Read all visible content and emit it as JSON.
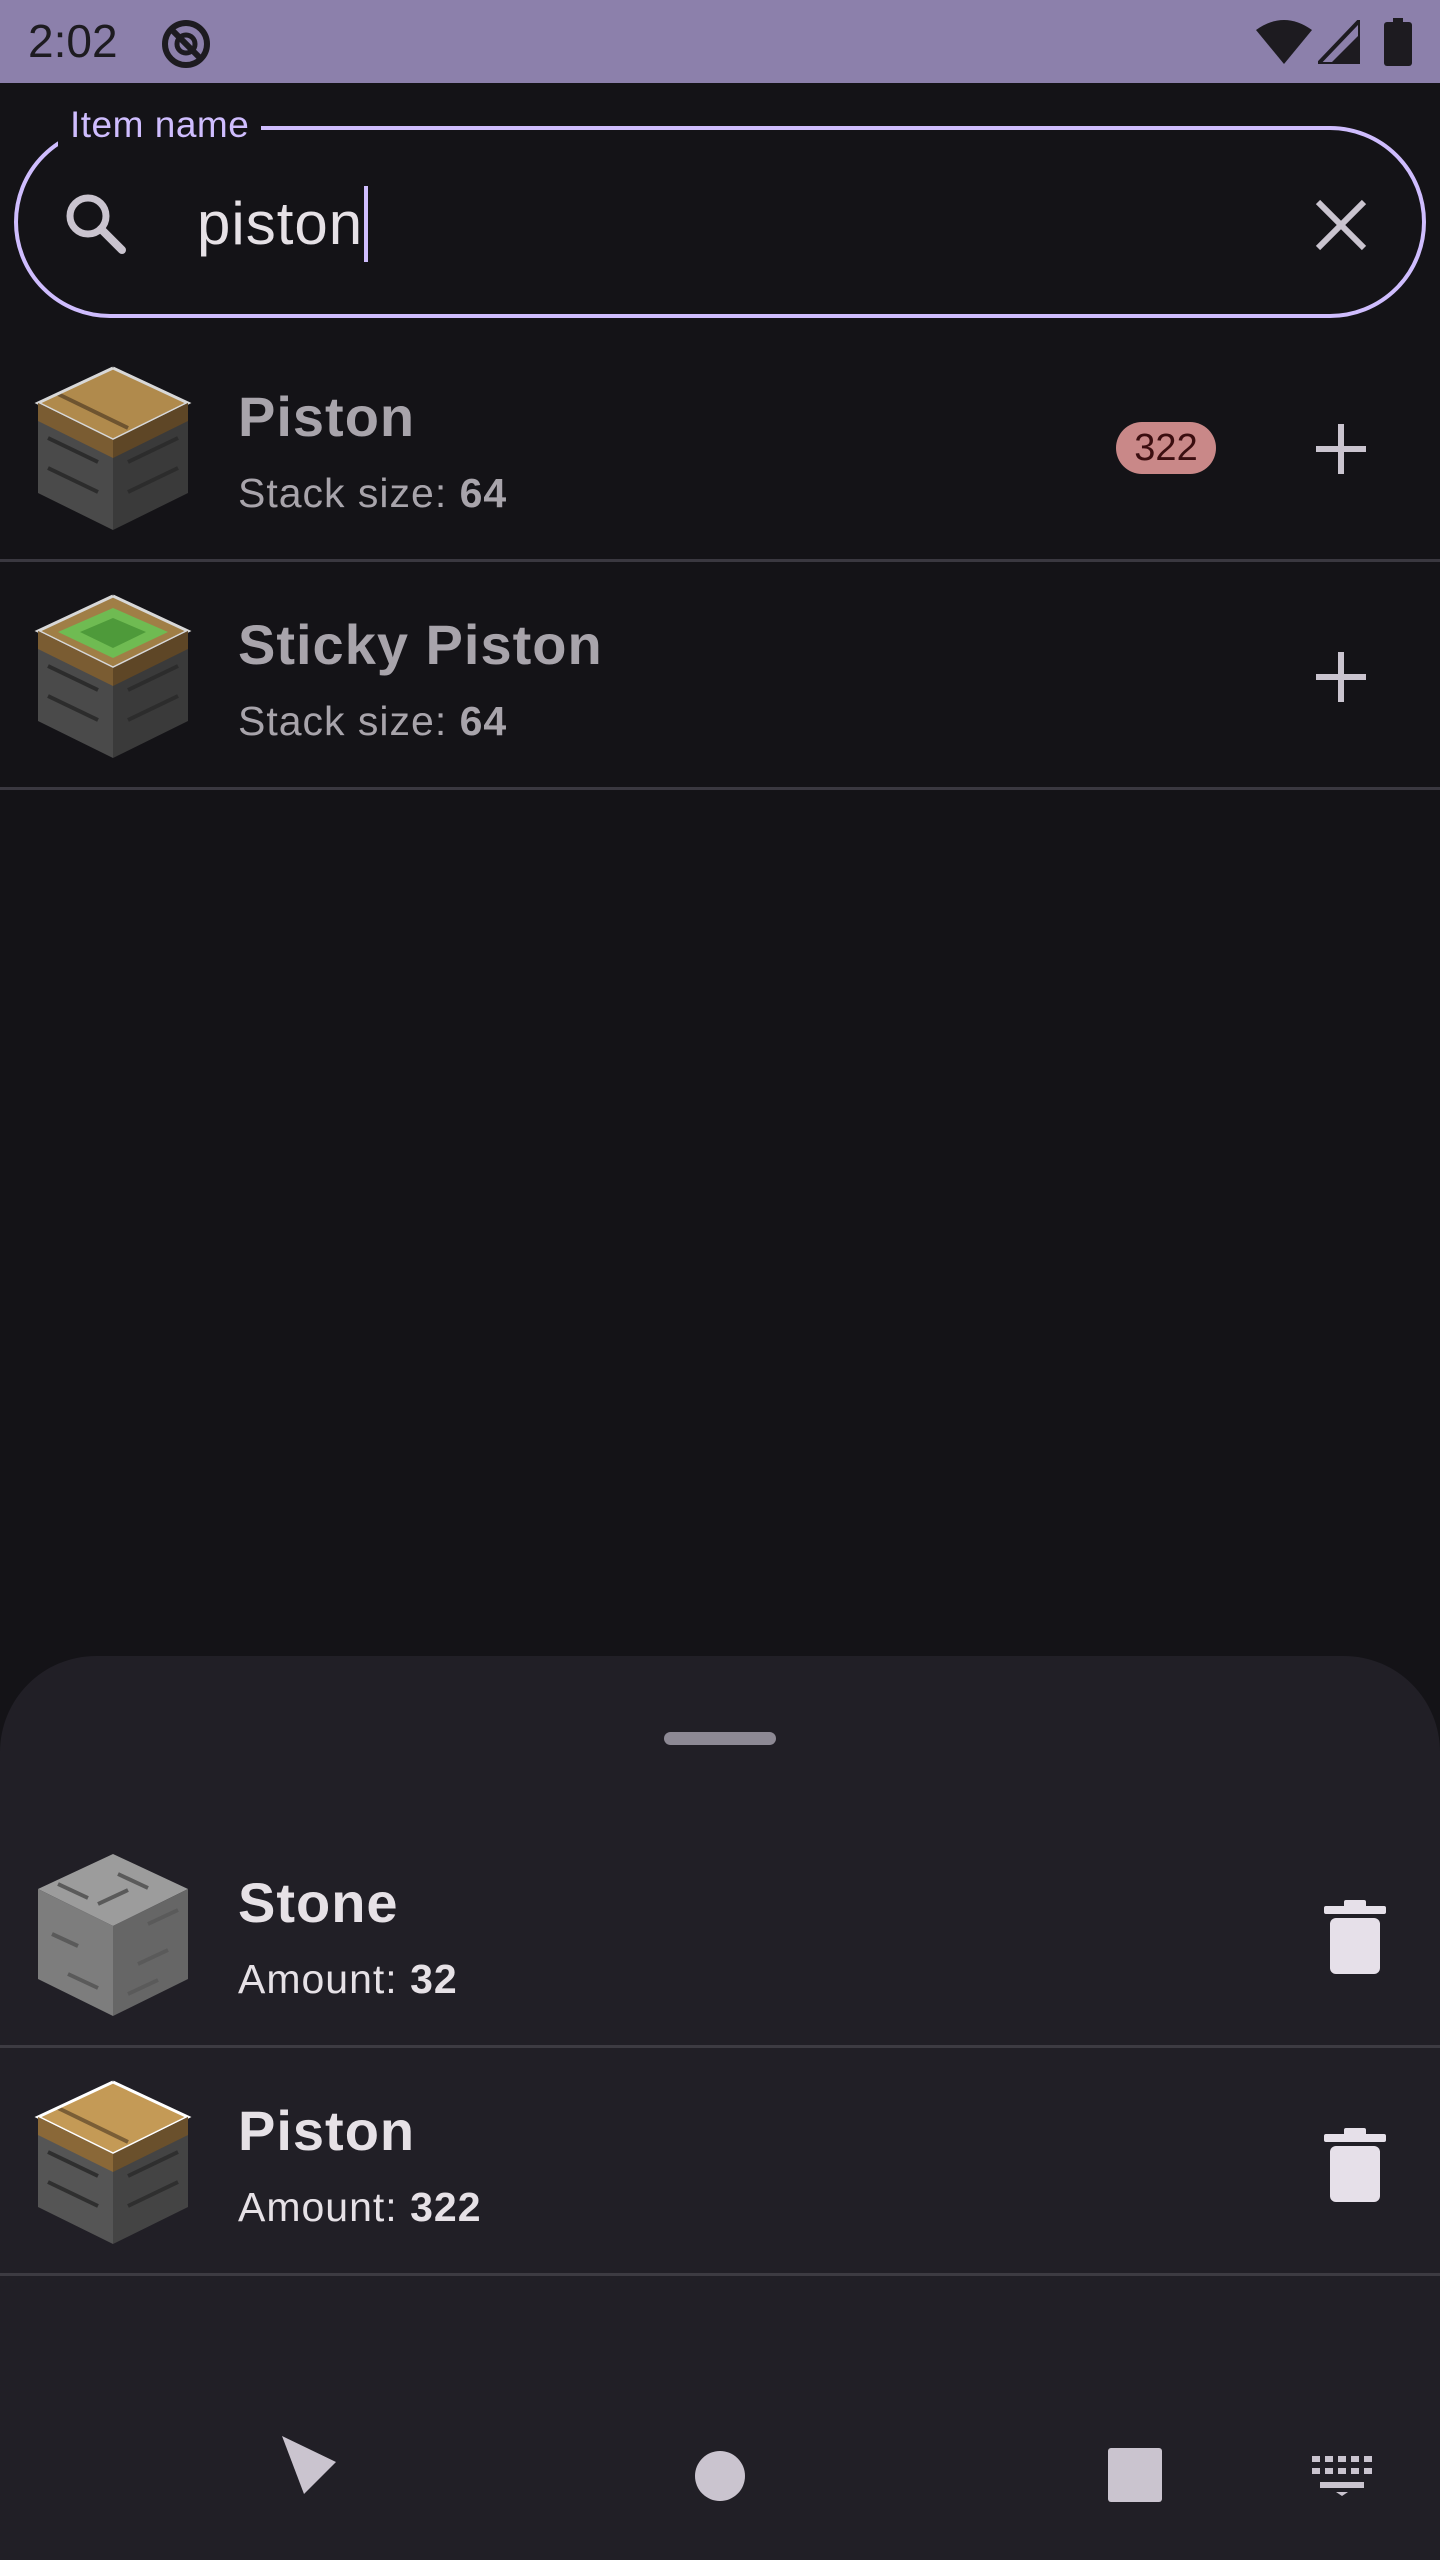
{
  "status_bar": {
    "time": "2:02",
    "icons": [
      "do-not-disturb-icon",
      "wifi-icon",
      "signal-icon",
      "battery-icon"
    ]
  },
  "search": {
    "label": "Item name",
    "value": "piston",
    "icons": [
      "search-icon",
      "clear-icon"
    ]
  },
  "results": [
    {
      "name": "Piston",
      "stack_label": "Stack size: ",
      "stack_size": "64",
      "badge": "322",
      "icon": "piston-block-icon"
    },
    {
      "name": "Sticky Piston",
      "stack_label": "Stack size: ",
      "stack_size": "64",
      "icon": "sticky-piston-block-icon"
    }
  ],
  "sheet": {
    "items": [
      {
        "name": "Stone",
        "amount_label": "Amount: ",
        "amount": "32",
        "icon": "stone-block-icon"
      },
      {
        "name": "Piston",
        "amount_label": "Amount: ",
        "amount": "322",
        "icon": "piston-block-icon"
      }
    ]
  },
  "nav_bar": {
    "icons": [
      "back-icon",
      "home-icon",
      "recents-icon",
      "keyboard-icon"
    ]
  },
  "colors": {
    "accent": "#cfbdfe",
    "status_bar": "#8c80ab",
    "background": "#141317",
    "sheet": "#211f26",
    "badge": "#c98888"
  }
}
